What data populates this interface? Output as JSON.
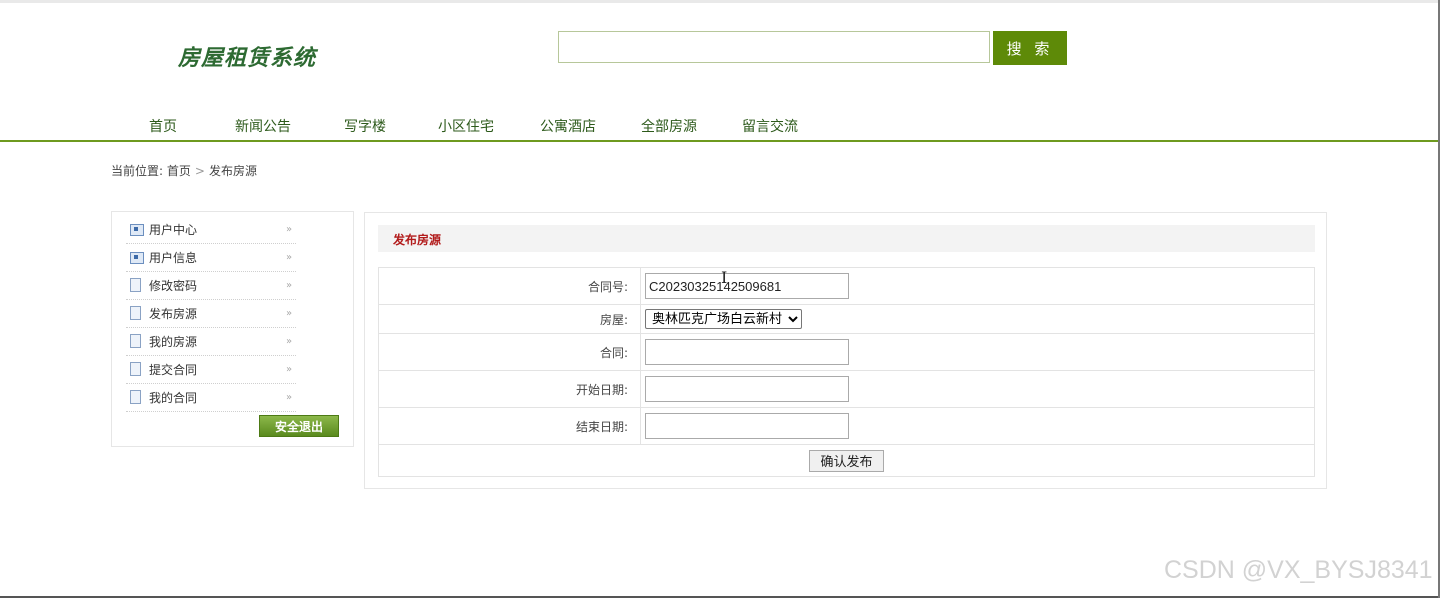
{
  "header": {
    "logo_text": "房屋租赁系统",
    "search": {
      "value": "",
      "button_label": "搜 索"
    }
  },
  "nav": {
    "items": [
      {
        "label": "首页"
      },
      {
        "label": "新闻公告"
      },
      {
        "label": "写字楼"
      },
      {
        "label": "小区住宅"
      },
      {
        "label": "公寓酒店"
      },
      {
        "label": "全部房源"
      },
      {
        "label": "留言交流"
      }
    ]
  },
  "breadcrumb": {
    "prefix": "当前位置:",
    "home": "首页",
    "separator": ">",
    "current": "发布房源"
  },
  "sidebar": {
    "items": [
      {
        "label": "用户中心",
        "icon": "user-card-icon"
      },
      {
        "label": "用户信息",
        "icon": "user-card-icon"
      },
      {
        "label": "修改密码",
        "icon": "document-icon"
      },
      {
        "label": "发布房源",
        "icon": "document-icon"
      },
      {
        "label": "我的房源",
        "icon": "document-icon"
      },
      {
        "label": "提交合同",
        "icon": "document-icon"
      },
      {
        "label": "我的合同",
        "icon": "document-icon"
      }
    ],
    "arrow": "»",
    "logout_label": "安全退出"
  },
  "form": {
    "title": "发布房源",
    "fields": {
      "contract_no": {
        "label": "合同号:",
        "value": "C20230325142509681"
      },
      "house": {
        "label": "房屋:",
        "selected": "奥林匹克广场白云新村"
      },
      "contract": {
        "label": "合同:",
        "value": ""
      },
      "start_date": {
        "label": "开始日期:",
        "value": ""
      },
      "end_date": {
        "label": "结束日期:",
        "value": ""
      }
    },
    "submit_label": "确认发布"
  },
  "cursor_glyph": "I",
  "watermark": "CSDN @VX_BYSJ8341",
  "colors": {
    "brand_green": "#5e8a08",
    "nav_text": "#2d5a1b",
    "title_red": "#b21b1b"
  }
}
